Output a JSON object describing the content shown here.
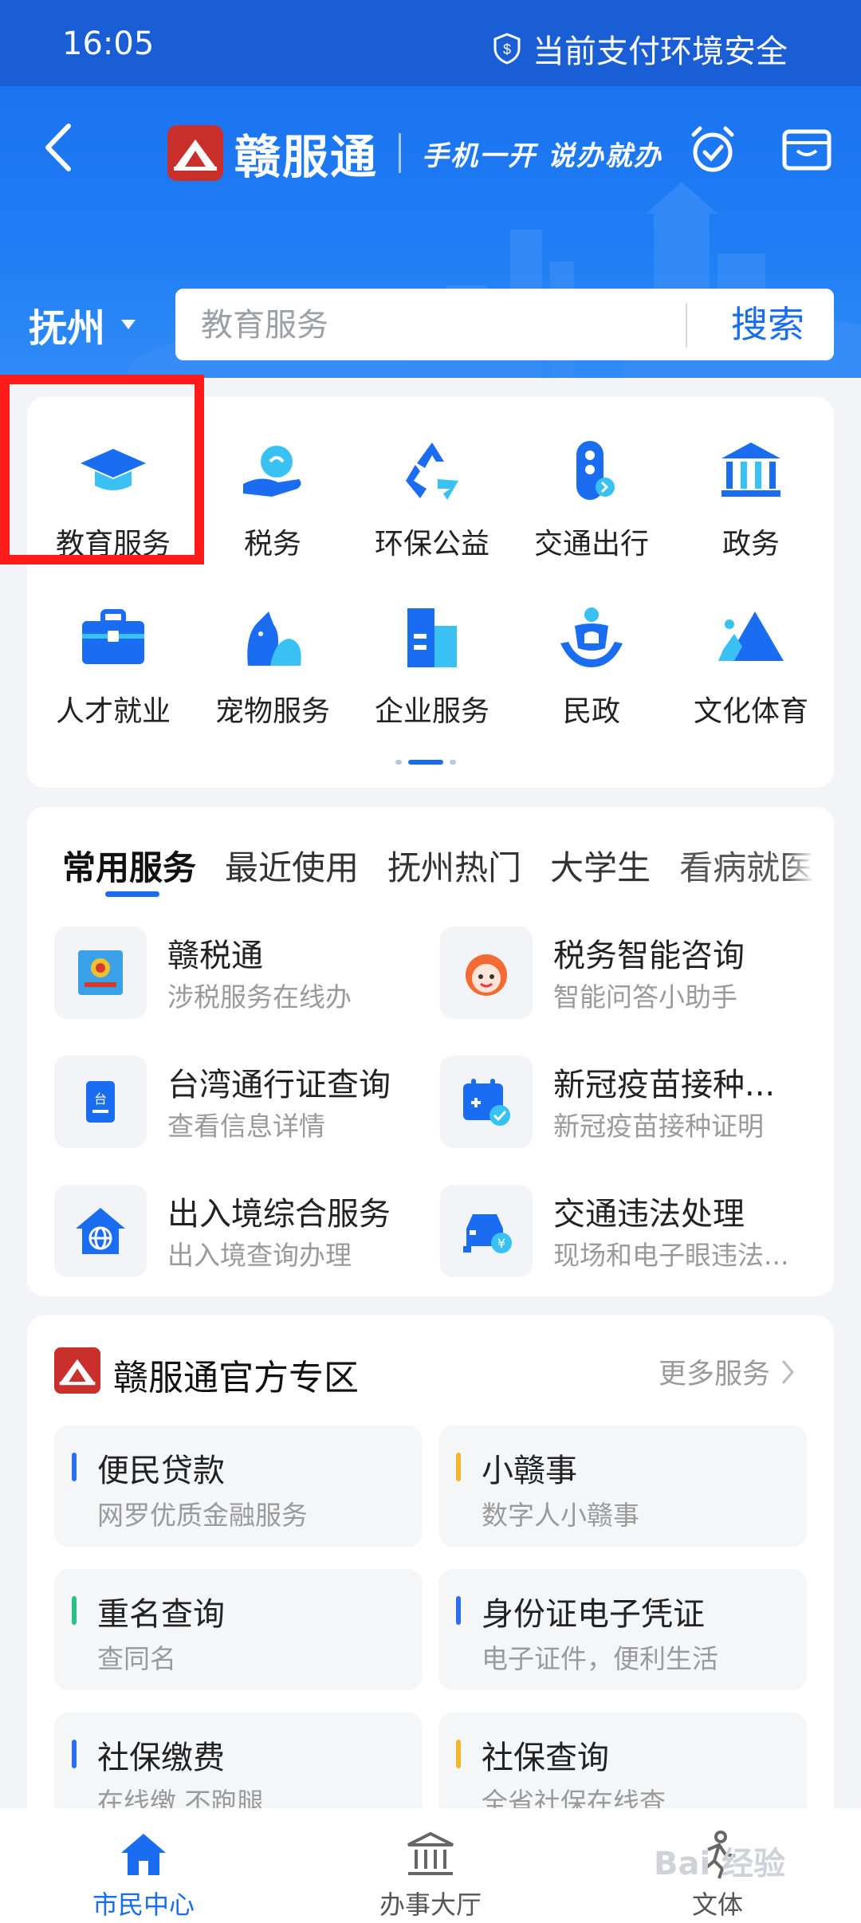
{
  "status_bar": {
    "time": "16:05",
    "safety_text": "当前支付环境安全"
  },
  "header": {
    "brand_name": "赣服通",
    "slogan": "手机一开  说办就办",
    "city": "抚州",
    "search_placeholder": "教育服务",
    "search_button": "搜索"
  },
  "categories": [
    {
      "label": "教育服务",
      "icon": "graduation-cap-icon"
    },
    {
      "label": "税务",
      "icon": "tax-hand-icon"
    },
    {
      "label": "环保公益",
      "icon": "recycle-icon"
    },
    {
      "label": "交通出行",
      "icon": "traffic-light-icon"
    },
    {
      "label": "政务",
      "icon": "government-building-icon"
    },
    {
      "label": "人才就业",
      "icon": "briefcase-icon"
    },
    {
      "label": "宠物服务",
      "icon": "pet-icon"
    },
    {
      "label": "企业服务",
      "icon": "enterprise-building-icon"
    },
    {
      "label": "民政",
      "icon": "civil-affairs-icon"
    },
    {
      "label": "文化体育",
      "icon": "culture-mountain-icon"
    }
  ],
  "service_tabs": [
    "常用服务",
    "最近使用",
    "抚州热门",
    "大学生",
    "看病就医"
  ],
  "services": [
    {
      "title": "赣税通",
      "subtitle": "涉税服务在线办",
      "icon": "tax-emblem-icon"
    },
    {
      "title": "税务智能咨询",
      "subtitle": "智能问答小助手",
      "icon": "assistant-face-icon"
    },
    {
      "title": "台湾通行证查询",
      "subtitle": "查看信息详情",
      "icon": "permit-card-icon"
    },
    {
      "title": "新冠疫苗接种...",
      "subtitle": "新冠疫苗接种证明",
      "icon": "calendar-check-icon"
    },
    {
      "title": "出入境综合服务",
      "subtitle": "出入境查询办理",
      "icon": "globe-house-icon"
    },
    {
      "title": "交通违法处理",
      "subtitle": "现场和电子眼违法...",
      "icon": "car-fine-icon"
    }
  ],
  "official_zone": {
    "title": "赣服通官方专区",
    "more": "更多服务",
    "items": [
      {
        "title": "便民贷款",
        "subtitle": "网罗优质金融服务",
        "color": "#2a6ff0"
      },
      {
        "title": "小赣事",
        "subtitle": "数字人小赣事",
        "color": "#f3b52a"
      },
      {
        "title": "重名查询",
        "subtitle": "查同名",
        "color": "#2dbf8a"
      },
      {
        "title": "身份证电子凭证",
        "subtitle": "电子证件，便利生活",
        "color": "#2a6ff0"
      },
      {
        "title": "社保缴费",
        "subtitle": "在线缴 不跑腿",
        "color": "#2a6ff0"
      },
      {
        "title": "社保查询",
        "subtitle": "全省社保在线查",
        "color": "#f3b52a"
      }
    ]
  },
  "bottom_nav": [
    {
      "label": "市民中心",
      "active": true
    },
    {
      "label": "办事大厅",
      "active": false
    },
    {
      "label": "文体",
      "active": false
    }
  ],
  "watermark": "Bai 经验"
}
